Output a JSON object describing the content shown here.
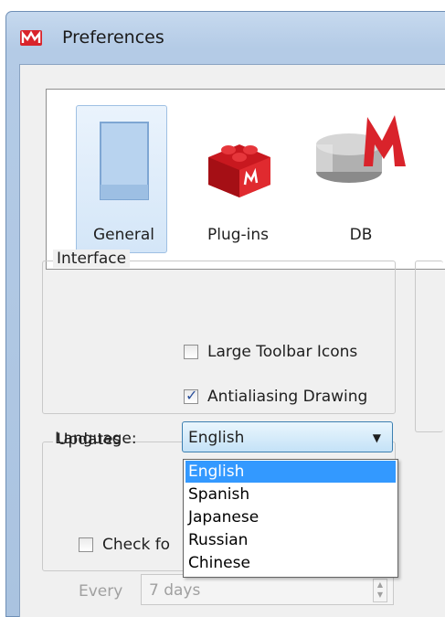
{
  "window": {
    "title": "Preferences"
  },
  "toolbar": {
    "tabs": [
      {
        "label": "General",
        "icon": "general-page-icon",
        "selected": true
      },
      {
        "label": "Plug-ins",
        "icon": "plugin-brick-icon",
        "selected": false
      },
      {
        "label": "DB",
        "icon": "database-icon",
        "selected": false
      }
    ]
  },
  "interface": {
    "legend": "Interface",
    "large_toolbar_icons": {
      "label": "Large Toolbar Icons",
      "checked": false
    },
    "antialiasing_drawing": {
      "label": "Antialiasing Drawing",
      "checked": true
    },
    "language": {
      "label": "Language:",
      "selected": "English",
      "options": [
        "English",
        "Spanish",
        "Japanese",
        "Russian",
        "Chinese"
      ]
    }
  },
  "updates": {
    "legend": "Updates",
    "check_label": "Check fo",
    "every_label": "Every",
    "interval_value": "7 days"
  },
  "colors": {
    "selection": "#3399ff",
    "accent_red": "#d9232b",
    "window_frame": "#b4cbe6"
  }
}
